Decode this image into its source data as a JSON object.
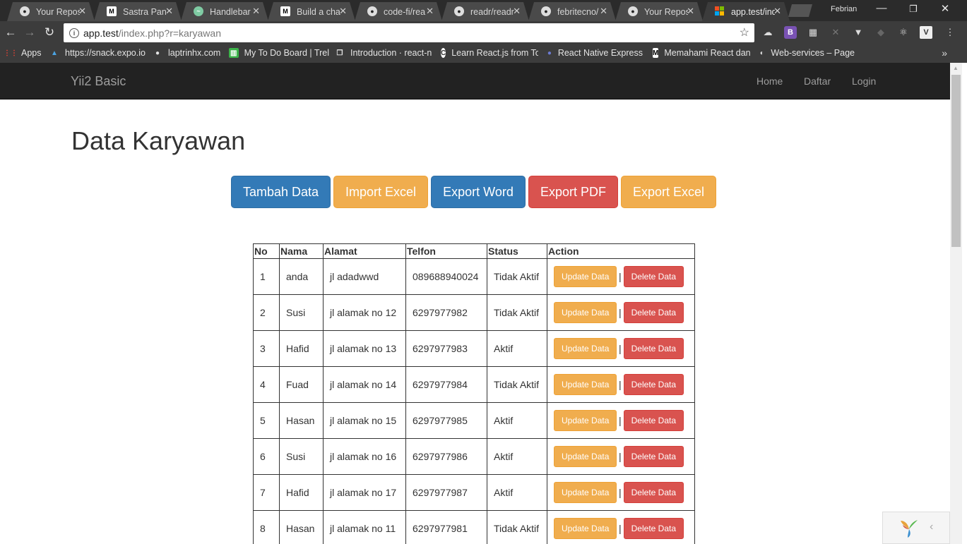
{
  "browser": {
    "tabs": [
      {
        "title": "Your Reposi",
        "icon": "github-icon",
        "active": false
      },
      {
        "title": "Sastra Panc",
        "icon": "medium-icon",
        "active": false
      },
      {
        "title": "Handlebar",
        "icon": "handlebars-icon",
        "active": false
      },
      {
        "title": "Build a chat",
        "icon": "medium-icon",
        "active": false
      },
      {
        "title": "code-fi/rea",
        "icon": "github-icon",
        "active": false
      },
      {
        "title": "readr/readr",
        "icon": "github-icon",
        "active": false
      },
      {
        "title": "febritecno/",
        "icon": "github-icon",
        "active": false
      },
      {
        "title": "Your Reposi",
        "icon": "github-icon",
        "active": false
      },
      {
        "title": "app.test/ind",
        "icon": "yii-icon",
        "active": true
      }
    ],
    "profile_name": "Febrian",
    "address": {
      "host": "app.test",
      "path": "/index.php?r=karyawan"
    },
    "bookmarks": [
      {
        "label": "Apps",
        "icon": "apps-icon"
      },
      {
        "label": "https://snack.expo.io",
        "icon": "expo-icon"
      },
      {
        "label": "laptrinhx.com",
        "icon": "dot-icon"
      },
      {
        "label": "My To Do Board | Trel",
        "icon": "trello-icon"
      },
      {
        "label": "Introduction · react-n",
        "icon": "book-icon"
      },
      {
        "label": "Learn React.js from To",
        "icon": "react-course-icon"
      },
      {
        "label": "React Native Express",
        "icon": "react-native-icon"
      },
      {
        "label": "Memahami React dan",
        "icon": "medium-icon"
      },
      {
        "label": "Web-services – Page",
        "icon": "web-services-icon"
      }
    ],
    "bookmarks_more": "»"
  },
  "app": {
    "brand": "Yii2 Basic",
    "nav": [
      {
        "label": "Home"
      },
      {
        "label": "Daftar"
      },
      {
        "label": "Login"
      }
    ],
    "page_title": "Data Karyawan",
    "actions": [
      {
        "label": "Tambah Data",
        "style": "primary"
      },
      {
        "label": "Import Excel",
        "style": "warning"
      },
      {
        "label": "Export Word",
        "style": "primary"
      },
      {
        "label": "Export PDF",
        "style": "danger"
      },
      {
        "label": "Export Excel",
        "style": "warning"
      }
    ],
    "table": {
      "headers": [
        "No",
        "Nama",
        "Alamat",
        "Telfon",
        "Status",
        "Action"
      ],
      "update_label": "Update Data",
      "delete_label": "Delete Data",
      "separator": "|",
      "rows": [
        {
          "no": "1",
          "nama": "anda",
          "alamat": "jl adadwwd",
          "telfon": "089688940024",
          "status": "Tidak Aktif"
        },
        {
          "no": "2",
          "nama": "Susi",
          "alamat": "jl alamak no 12",
          "telfon": "6297977982",
          "status": "Tidak Aktif"
        },
        {
          "no": "3",
          "nama": "Hafid",
          "alamat": "jl alamak no 13",
          "telfon": "6297977983",
          "status": "Aktif"
        },
        {
          "no": "4",
          "nama": "Fuad",
          "alamat": "jl alamak no 14",
          "telfon": "6297977984",
          "status": "Tidak Aktif"
        },
        {
          "no": "5",
          "nama": "Hasan",
          "alamat": "jl alamak no 15",
          "telfon": "6297977985",
          "status": "Aktif"
        },
        {
          "no": "6",
          "nama": "Susi",
          "alamat": "jl alamak no 16",
          "telfon": "6297977986",
          "status": "Aktif"
        },
        {
          "no": "7",
          "nama": "Hafid",
          "alamat": "jl alamak no 17",
          "telfon": "6297977987",
          "status": "Aktif"
        },
        {
          "no": "8",
          "nama": "Hasan",
          "alamat": "jl alamak no 11",
          "telfon": "6297977981",
          "status": "Tidak Aktif"
        }
      ]
    }
  },
  "colors": {
    "primary": "#337ab7",
    "warning": "#f0ad4e",
    "danger": "#d9534f",
    "navbar": "#222222"
  }
}
